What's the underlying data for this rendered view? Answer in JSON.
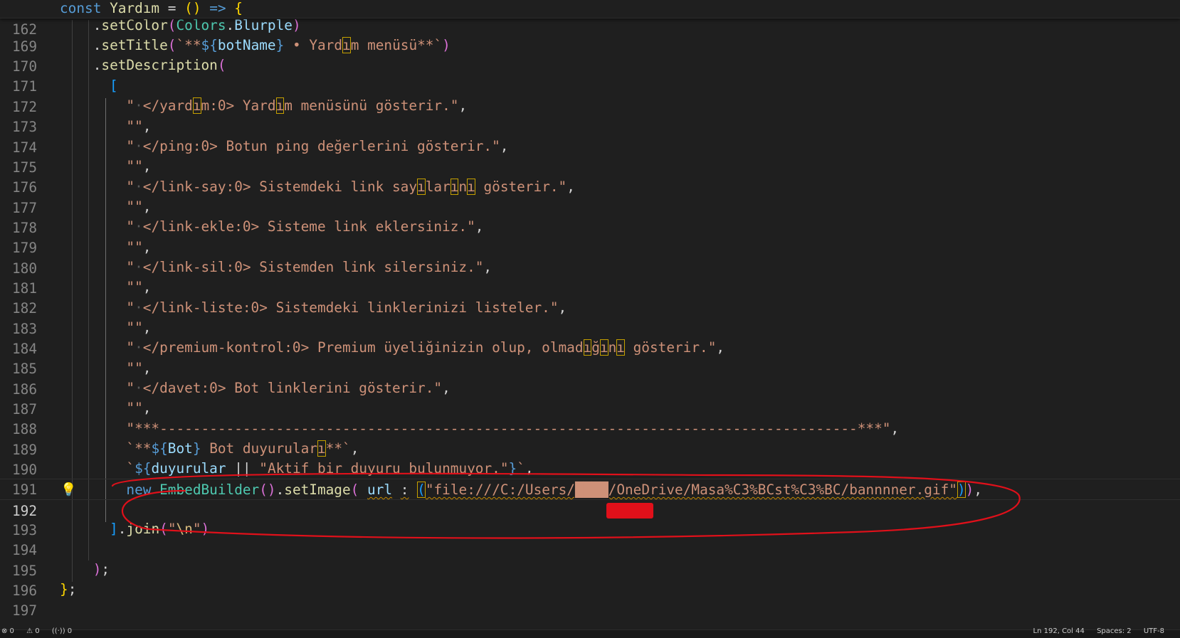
{
  "editor": {
    "sticky": {
      "number": "162",
      "text": "const Yardım = () => {"
    },
    "lines": [
      {
        "number": "169",
        "text": "    .setColor(Colors.Blurple)"
      },
      {
        "number": "170",
        "text": "    .setTitle(`**${botName} • Yardım menüsü**`)"
      },
      {
        "number": "171",
        "text": "    .setDescription("
      },
      {
        "number": "172",
        "text": "      ["
      },
      {
        "number": "173",
        "text": "        \"·</yardım:0> Yardım menüsünü gösterir.\","
      },
      {
        "number": "174",
        "text": "        \"\","
      },
      {
        "number": "175",
        "text": "        \"·</ping:0> Botun ping değerlerini gösterir.\","
      },
      {
        "number": "176",
        "text": "        \"\","
      },
      {
        "number": "177",
        "text": "        \"·</link-say:0> Sistemdeki link sayılarını gösterir.\","
      },
      {
        "number": "178",
        "text": "        \"\","
      },
      {
        "number": "179",
        "text": "        \"·</link-ekle:0> Sisteme link eklersiniz.\","
      },
      {
        "number": "180",
        "text": "        \"\","
      },
      {
        "number": "181",
        "text": "        \"·</link-sil:0> Sistemden link silersiniz.\","
      },
      {
        "number": "182",
        "text": "        \"\","
      },
      {
        "number": "183",
        "text": "        \"·</link-liste:0> Sistemdeki linklerinizi listeler.\","
      },
      {
        "number": "184",
        "text": "        \"\","
      },
      {
        "number": "185",
        "text": "        \"·</premium-kontrol:0> Premium üyeliğinizin olup, olmadığını gösterir.\","
      },
      {
        "number": "186",
        "text": "        \"\","
      },
      {
        "number": "187",
        "text": "        \"·</davet:0> Bot linklerini gösterir.\","
      },
      {
        "number": "188",
        "text": "        \"\","
      },
      {
        "number": "189",
        "text": "        \"***---------------------------------------------------------------------------------***\","
      },
      {
        "number": "190",
        "text": "        `**${Bot} Bot duyuruları**`,"
      },
      {
        "number": "191",
        "text": "        `${duyurular || \"Aktif bir duyuru bulunmuyor.\"}`,"
      },
      {
        "number": "192",
        "text": "        new EmbedBuilder().setImage( url : (\"file:///C:/Users/████/OneDrive/Masa%C3%BCst%C3%BC/bannnner.gif\")),"
      },
      {
        "number": "193",
        "text": ""
      },
      {
        "number": "194",
        "text": "      ].join(\"\\n\")"
      },
      {
        "number": "195",
        "text": ""
      },
      {
        "number": "196",
        "text": "    );"
      },
      {
        "number": "197",
        "text": "};"
      }
    ],
    "active_line": "192",
    "lightbulb_icon": "lightbulb-icon"
  },
  "statusbar": {
    "left": [
      "⊗ 0",
      "⚠ 0",
      "((·)) 0"
    ],
    "right": [
      "Ln 192, Col 44",
      "Spaces: 2",
      "UTF-8"
    ]
  },
  "colors": {
    "background": "#1f1f1f",
    "annotation": "#e0101a",
    "keyword": "#569cd6",
    "string": "#ce9178",
    "function": "#dcdcaa"
  }
}
